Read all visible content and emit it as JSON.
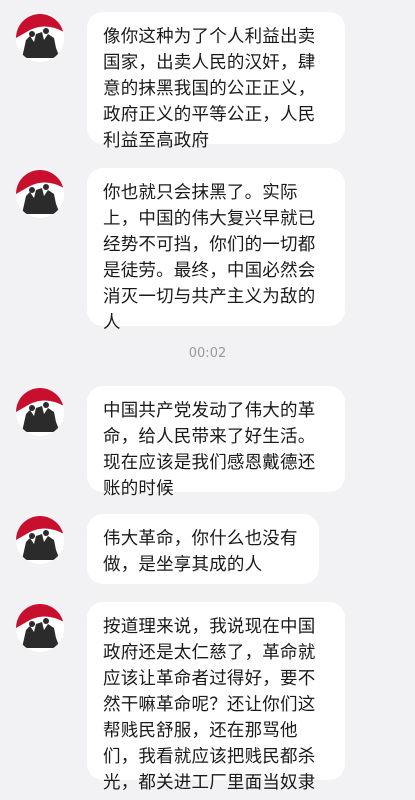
{
  "messages": [
    {
      "text": "像你这种为了个人利益出卖国家，出卖人民的汉奸，肆意的抹黑我国的公正正义，政府正义的平等公正，人民利益至高政府"
    },
    {
      "text": "你也就只会抹黑了。实际上，中国的伟大复兴早就已经势不可挡，你们的一切都是徒劳。最终，中国必然会消灭一切与共产主义为敌的人"
    },
    {
      "text": "中国共产党发动了伟大的革命，给人民带来了好生活。现在应该是我们感恩戴德还账的时候"
    },
    {
      "text": "伟大革命，你什么也没有做，是坐享其成的人"
    },
    {
      "text": "按道理来说，我说现在中国政府还是太仁慈了，革命就应该让革命者过得好，要不然干嘛革命呢？还让你们这帮贱民舒服，还在那骂他们，我看就应该把贱民都杀光，都关进工厂里面当奴隶"
    }
  ],
  "timestamp": "00:02",
  "colors": {
    "background": "#f2f2f4",
    "bubble": "#ffffff",
    "avatar_red": "#c8102e",
    "avatar_dark": "#2b2b2b"
  }
}
